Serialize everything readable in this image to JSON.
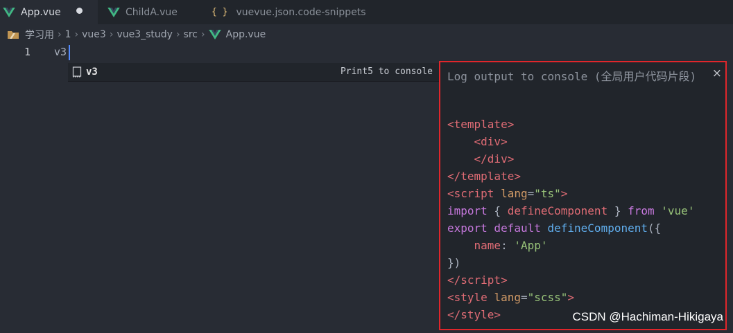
{
  "tabs": [
    {
      "label": "App.vue",
      "icon": "vue-icon",
      "active": true,
      "modified": true
    },
    {
      "label": "ChildA.vue",
      "icon": "vue-icon",
      "active": false
    },
    {
      "label": "vuevue.json.code-snippets",
      "icon": "json-braces-icon",
      "active": false
    }
  ],
  "breadcrumb": [
    "学习用",
    "1",
    "vue3",
    "vue3_study",
    "src",
    "App.vue"
  ],
  "editor": {
    "line_number": "1",
    "line_text": "v3"
  },
  "suggestion": {
    "label": "v3",
    "detail": "Print5 to console"
  },
  "details": {
    "title": "Log output to console (全局用户代码片段)",
    "close_glyph": "×"
  },
  "watermark": "CSDN @Hachiman-Hikigaya",
  "colors": {
    "accent": "#e0262b",
    "cursor": "#528bff",
    "vue_green": "#41b883"
  }
}
